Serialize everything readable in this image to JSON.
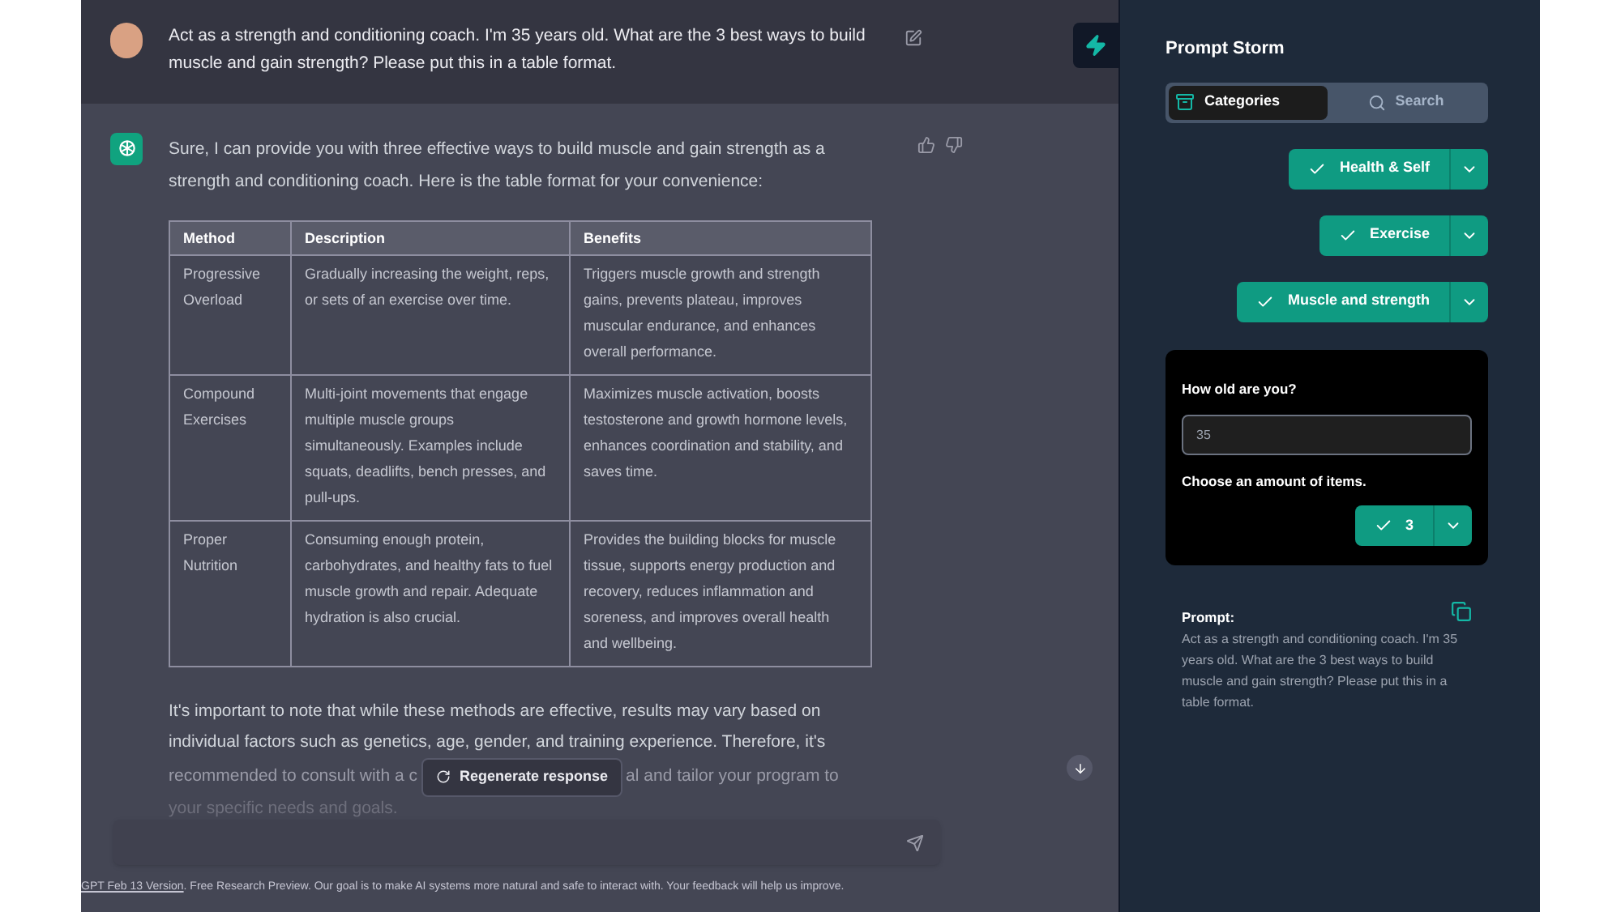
{
  "user_message": {
    "text": "Act as a strength and conditioning coach.  I'm 35 years old. What are the 3 best ways to build muscle and gain strength? Please put this in a table format."
  },
  "assistant_message": {
    "intro": "Sure, I can provide you with three effective ways to build muscle and gain strength as a strength and conditioning coach. Here is the table format for your convenience:",
    "table": {
      "columns": [
        "Method",
        "Description",
        "Benefits"
      ],
      "rows": [
        [
          "Progressive Overload",
          "Gradually increasing the weight, reps, or sets of an exercise over time.",
          "Triggers muscle growth and strength gains, prevents plateau, improves muscular endurance, and enhances overall performance."
        ],
        [
          "Compound Exercises",
          "Multi-joint movements that engage multiple muscle groups simultaneously. Examples include squats, deadlifts, bench presses, and pull-ups.",
          "Maximizes muscle activation, boosts testosterone and growth hormone levels, enhances coordination and stability, and saves time."
        ],
        [
          "Proper Nutrition",
          "Consuming enough protein, carbohydrates, and healthy fats to fuel muscle growth and repair. Adequate hydration is also crucial.",
          "Provides the building blocks for muscle tissue, supports energy production and recovery, reduces inflammation and soreness, and improves overall health and wellbeing."
        ]
      ]
    },
    "closing": {
      "line_1": "It's important to note that while these methods are effective, results may vary based on",
      "line_2": "individual factors such as genetics, age, gender, and training experience. Therefore, it's",
      "line_3_left": "recommended to consult with a c",
      "line_3_right": "al and tailor your program to",
      "line_4": "your specific needs and goals."
    }
  },
  "regenerate_button": {
    "label": "Regenerate response"
  },
  "footer": {
    "link": "GPT Feb 13 Version",
    "text": ". Free Research Preview. Our goal is to make AI systems more natural and safe to interact with. Your feedback will help us improve."
  },
  "sidebar": {
    "title": "Prompt Storm",
    "tabs": [
      {
        "label": "Categories",
        "selected": true
      },
      {
        "label": "Search",
        "selected": false
      }
    ],
    "selectors": [
      {
        "label": "Health & Self"
      },
      {
        "label": "Exercise"
      },
      {
        "label": "Muscle and strength"
      }
    ],
    "form": {
      "question": "How old are you?",
      "age_value": "35",
      "items_label": "Choose an amount of items.",
      "items_value": "3"
    },
    "prompt": {
      "label": "Prompt:",
      "text": "Act as a strength and conditioning coach. I'm 35 years old. What are the 3 best ways to build muscle and gain strength? Please put this in a table format."
    }
  }
}
